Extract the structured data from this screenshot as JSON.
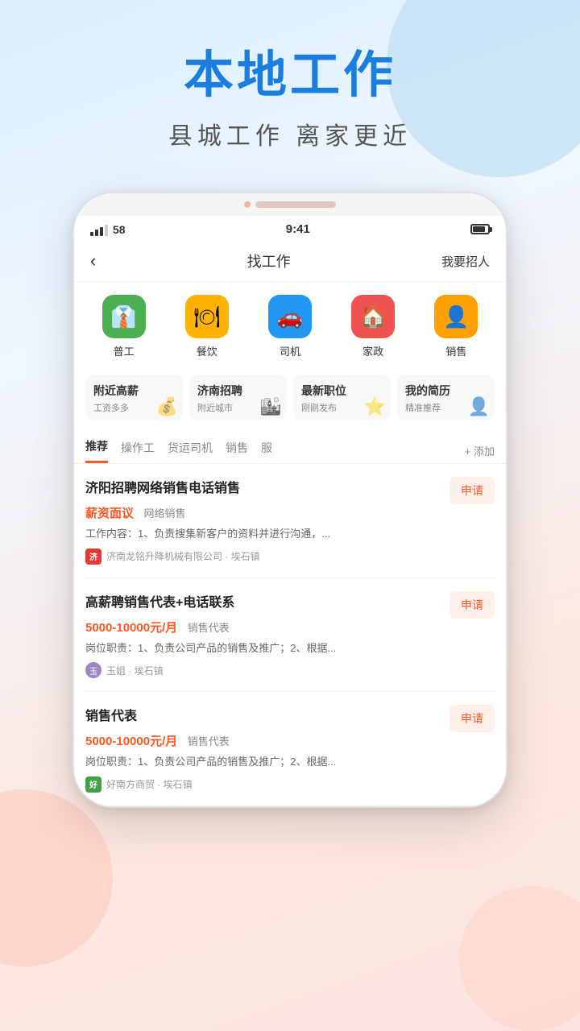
{
  "page": {
    "background_title": "本地工作",
    "background_subtitle": "县城工作  离家更近"
  },
  "status_bar": {
    "signal": "58",
    "time": "9:41",
    "battery": "85"
  },
  "nav": {
    "back_icon": "‹",
    "title": "找工作",
    "right_action": "我要招人"
  },
  "categories": [
    {
      "id": "general",
      "label": "普工",
      "icon": "👔",
      "color": "cat-green"
    },
    {
      "id": "food",
      "label": "餐饮",
      "icon": "🍽",
      "color": "cat-yellow"
    },
    {
      "id": "driver",
      "label": "司机",
      "icon": "🚗",
      "color": "cat-blue"
    },
    {
      "id": "domestic",
      "label": "家政",
      "icon": "🏠",
      "color": "cat-red"
    },
    {
      "id": "sales",
      "label": "销售",
      "icon": "👤",
      "color": "cat-amber"
    }
  ],
  "quick_cards": [
    {
      "title": "附近高薪",
      "sub": "工资多多",
      "emoji": "💰"
    },
    {
      "title": "济南招聘",
      "sub": "附近城市",
      "emoji": "🏙"
    },
    {
      "title": "最新职位",
      "sub": "刚刚发布",
      "emoji": "⭐"
    },
    {
      "title": "我的简历",
      "sub": "精准推荐",
      "emoji": "👤"
    }
  ],
  "tabs": [
    {
      "id": "recommend",
      "label": "推荐",
      "active": true
    },
    {
      "id": "operator",
      "label": "操作工",
      "active": false
    },
    {
      "id": "freight",
      "label": "货运司机",
      "active": false
    },
    {
      "id": "sales",
      "label": "销售",
      "active": false
    },
    {
      "id": "more",
      "label": "服",
      "active": false
    }
  ],
  "tab_add_label": "+ 添加",
  "jobs": [
    {
      "id": "job1",
      "title": "济阳招聘网络销售电话销售",
      "salary": "薪资面议",
      "salary_type": "negotiable",
      "tag": "网络销售",
      "desc": "工作内容：1、负责搜集新客户的资料并进行沟通，...",
      "company": "济南龙铭升降机械有限公司 · 埃石镇",
      "company_logo_type": "logo",
      "company_logo_color": "logo-red",
      "company_logo_text": "济",
      "apply_label": "申请"
    },
    {
      "id": "job2",
      "title": "高薪聘销售代表+电话联系",
      "salary": "5000-10000元/月",
      "salary_type": "range",
      "tag": "销售代表",
      "desc": "岗位职责：1、负责公司产品的销售及推广；2、根据...",
      "company": "玉姐 · 埃石镇",
      "company_logo_type": "avatar",
      "company_logo_color": "logo-avatar",
      "company_logo_text": "玉",
      "apply_label": "申请"
    },
    {
      "id": "job3",
      "title": "销售代表",
      "salary": "5000-10000元/月",
      "salary_type": "range",
      "tag": "销售代表",
      "desc": "岗位职责：1、负责公司产品的销售及推广；2、根据...",
      "company": "好南方商贸 · 埃石镇",
      "company_logo_type": "logo",
      "company_logo_color": "logo-green",
      "company_logo_text": "好",
      "apply_label": "申请"
    }
  ]
}
